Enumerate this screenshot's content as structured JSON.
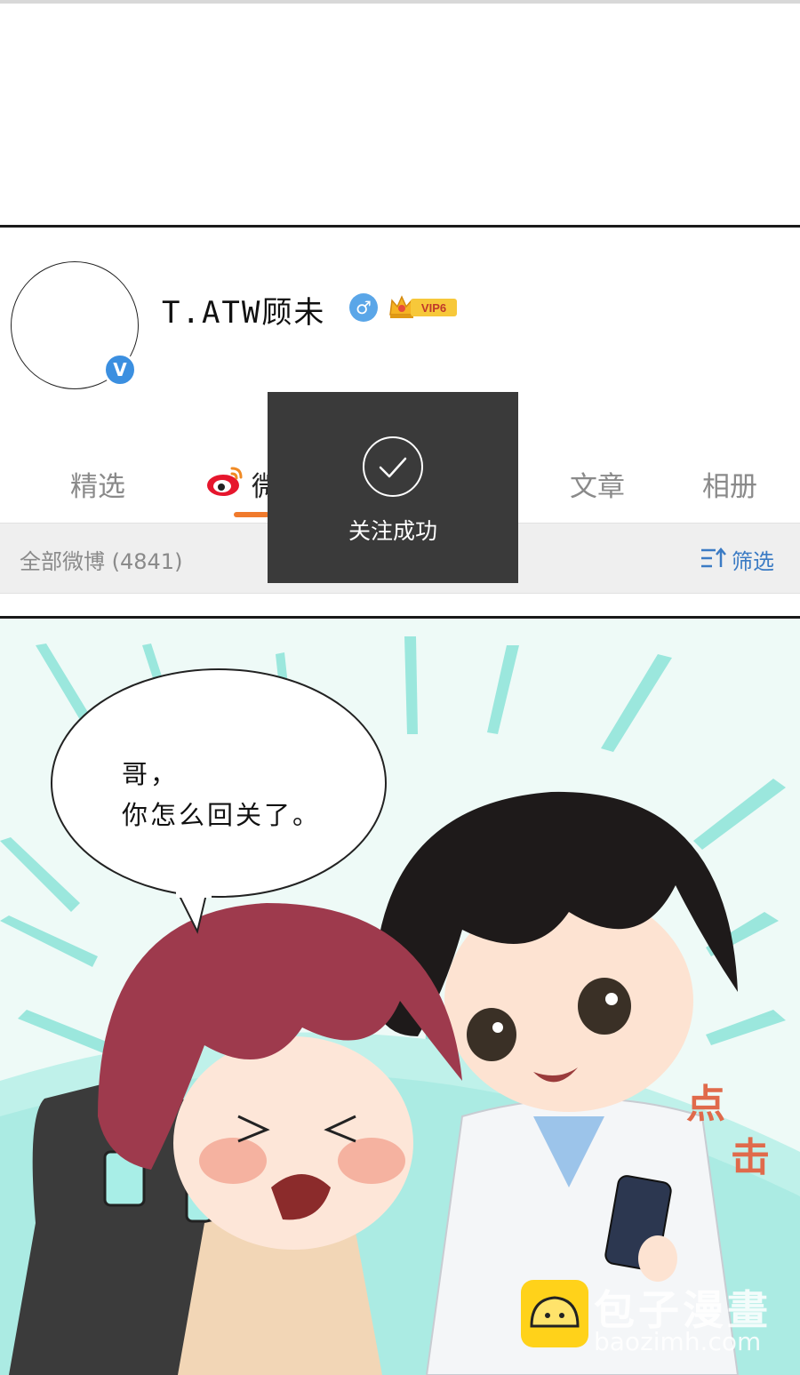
{
  "profile": {
    "username": "T.ATW顾未",
    "gender_icon": "male-symbol",
    "vip_label": "VIP6",
    "verified_icon": "verified-v"
  },
  "tabs": [
    {
      "label": "精选"
    },
    {
      "label": "微"
    },
    {
      "label": "文章"
    },
    {
      "label": "相册"
    }
  ],
  "filter_bar": {
    "all_weibo_label": "全部微博 (4841)",
    "filter_label": "筛选"
  },
  "toast": {
    "message": "关注成功"
  },
  "comic": {
    "speech_line_1": "哥，",
    "speech_line_2": "你怎么回关了。",
    "sfx_1": "点",
    "sfx_2": "击",
    "watermark_text": "包子漫畫",
    "watermark_url": "baozimh.com"
  },
  "colors": {
    "accent_orange": "#f07a2c",
    "link_blue": "#3b7bc4",
    "toast_bg": "#3a3a3a",
    "verified_blue": "#3b8fe0",
    "comic_bg": "#eefaf7"
  }
}
